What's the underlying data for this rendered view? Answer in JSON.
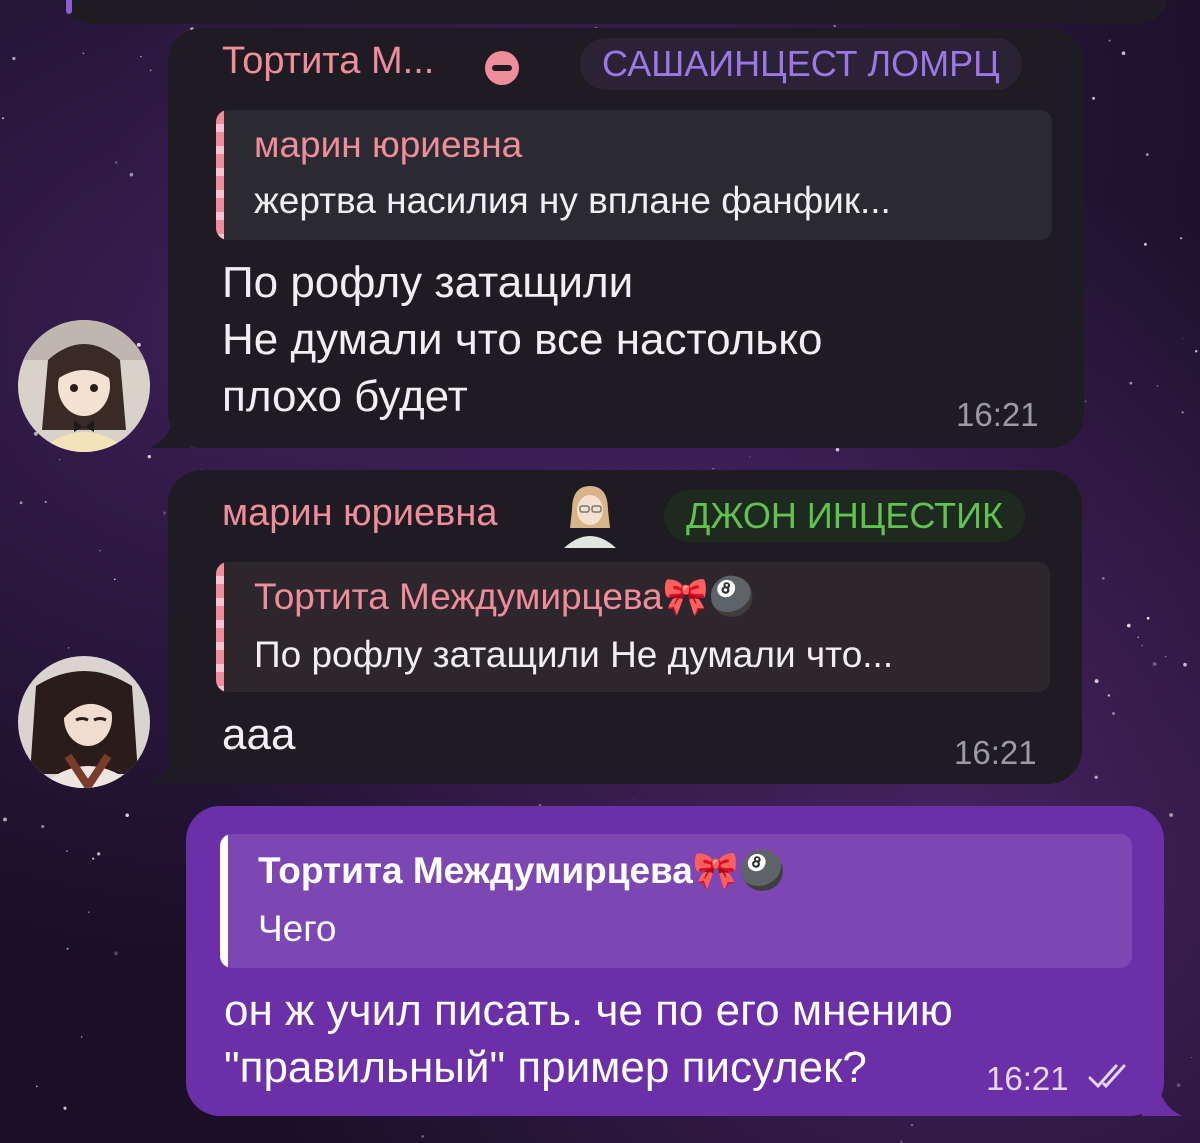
{
  "messages": [
    {
      "sender": "Тортита М...",
      "badge": "САШАИНЦЕСТ ЛОМРЦ",
      "reply": {
        "name": "марин юриевна",
        "text": "жертва насилия  ну вплане фанфик..."
      },
      "lines": [
        "По рофлу затащили",
        "Не думали что все настолько",
        "плохо будет"
      ],
      "time": "16:21",
      "avatar": "anime-girl-avatar"
    },
    {
      "sender": "марин юриевна",
      "badge": "ДЖОН ИНЦЕСТИК",
      "reply": {
        "name": "Тортита Междумирцева",
        "emoji": "🎀🎱",
        "text": "По рофлу затащили  Не думали что..."
      },
      "lines": [
        "ааа"
      ],
      "time": "16:21",
      "avatar": "anime-boy-avatar"
    },
    {
      "outgoing": true,
      "reply": {
        "name": "Тортита Междумирцева",
        "emoji": "🎀🎱",
        "text": "Чего"
      },
      "lines": [
        "он ж учил писать. че по его мнению",
        "\"правильный\" пример писулек?"
      ],
      "time": "16:21",
      "status": "read"
    }
  ],
  "colors": {
    "incoming_bubble": "#1e1c22",
    "outgoing_bubble": "#6b2fa8",
    "sender_name": "#ef8d9b",
    "badge_purple": "#9c78e6",
    "badge_green": "#61c24f"
  }
}
